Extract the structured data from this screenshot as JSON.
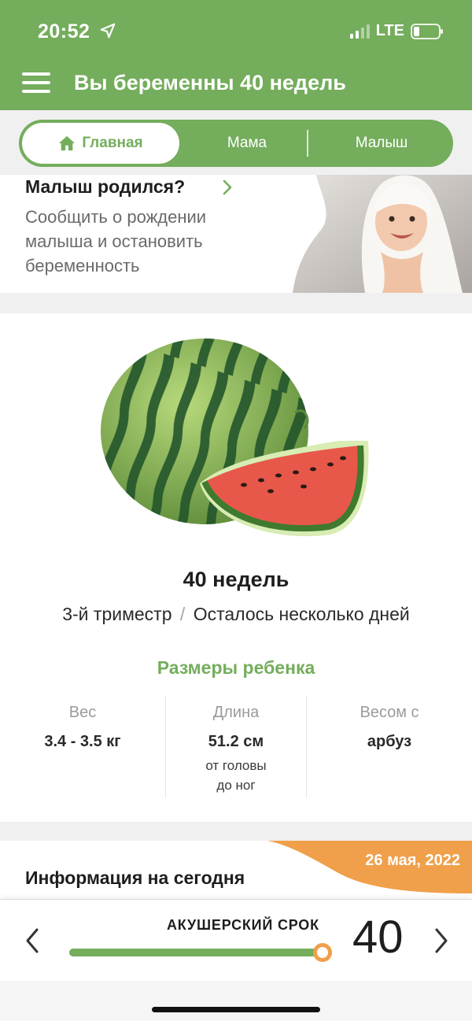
{
  "status_bar": {
    "time": "20:52",
    "network": "LTE",
    "icons": [
      "location-arrow-icon",
      "signal-bars-icon",
      "battery-icon"
    ]
  },
  "header": {
    "title": "Вы беременны 40 недель",
    "menu_icon": "hamburger-menu-icon",
    "color": "#74ad5c"
  },
  "tabs": [
    {
      "label": "Главная",
      "active": true,
      "icon": "home-icon"
    },
    {
      "label": "Мама",
      "active": false
    },
    {
      "label": "Малыш",
      "active": false
    }
  ],
  "born_card": {
    "title": "Малыш родился?",
    "description": "Сообщить о рождении малыша и остановить беременность",
    "image": "baby-under-blanket-photo"
  },
  "fruit_card": {
    "image": "watermelon-illustration",
    "weeks": "40 недель",
    "trimester": "3-й триместр",
    "separator": "/",
    "remaining": "Осталось несколько дней",
    "sizes_title": "Размеры ребенка",
    "sizes": [
      {
        "label": "Вес",
        "value": "3.4 - 3.5 кг"
      },
      {
        "label": "Длина",
        "value": "51.2 см",
        "note_line1": "от головы",
        "note_line2": "до ног"
      },
      {
        "label": "Весом с",
        "value": "арбуз"
      }
    ]
  },
  "info_card": {
    "title": "Информация на сегодня",
    "date": "26 мая, 2022",
    "badge_color": "#f0a04a"
  },
  "bottom_bar": {
    "label": "АКУШЕРСКИЙ СРОК",
    "week": "40",
    "slider_progress": 1.0
  },
  "colors": {
    "accent": "#74ad5c",
    "badge": "#f0a04a"
  }
}
